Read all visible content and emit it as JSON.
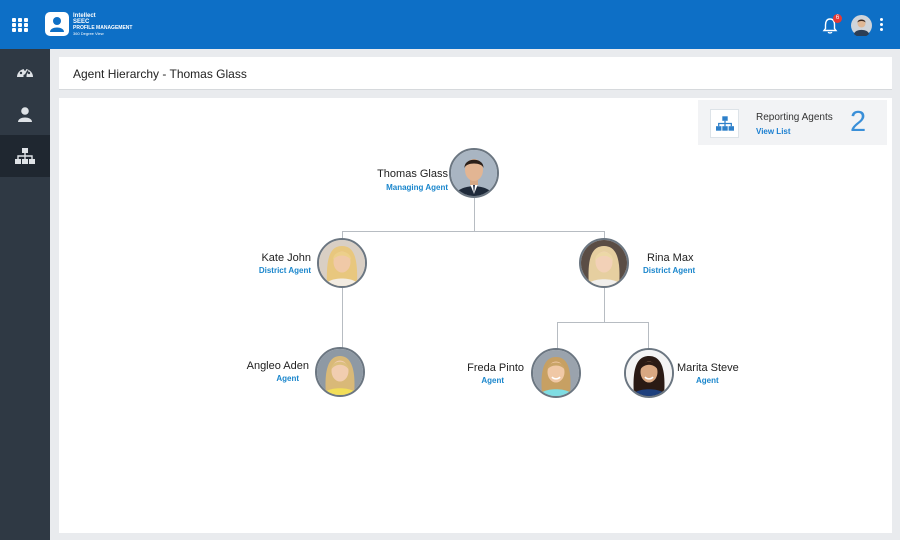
{
  "app": {
    "logo_lines": [
      "Intellect",
      "SEEC",
      "PROFILE MANAGEMENT",
      "360 Degree View"
    ],
    "notification_count": "6"
  },
  "sidebar": {
    "items": [
      {
        "icon": "dashboard-icon"
      },
      {
        "icon": "user-icon"
      },
      {
        "icon": "hierarchy-icon",
        "active": true
      }
    ]
  },
  "page": {
    "title": "Agent Hierarchy - Thomas Glass"
  },
  "reporting": {
    "label": "Reporting Agents",
    "link": "View List",
    "count": "2"
  },
  "hierarchy": {
    "root": {
      "name": "Thomas Glass",
      "role": "Managing Agent"
    },
    "level1": [
      {
        "name": "Kate John",
        "role": "District Agent"
      },
      {
        "name": "Rina Max",
        "role": "District Agent"
      }
    ],
    "level2": [
      {
        "name": "Angleo Aden",
        "role": "Agent"
      },
      {
        "name": "Freda Pinto",
        "role": "Agent"
      },
      {
        "name": "Marita Steve",
        "role": "Agent"
      }
    ]
  },
  "colors": {
    "topbar": "#0d6fc6",
    "sidebar": "#2f3944",
    "role_text": "#1a86cc",
    "link": "#1a7fd1"
  }
}
